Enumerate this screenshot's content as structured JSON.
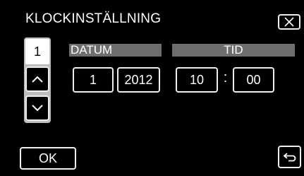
{
  "header": {
    "title": "KLOCKINSTÄLLNING"
  },
  "icons": {
    "close": "close-x-icon",
    "back": "return-arrow-icon",
    "up": "chevron-up-icon",
    "down": "chevron-down-icon"
  },
  "stepper": {
    "value": "1"
  },
  "date": {
    "label": "DATUM",
    "day": "1",
    "year": "2012"
  },
  "time": {
    "label": "TID",
    "hour": "10",
    "separator": ":",
    "minute": "00"
  },
  "footer": {
    "ok_label": "OK"
  },
  "colors": {
    "background": "#000000",
    "header_bar": "#6e6e6e",
    "border": "#ededed",
    "stepper_frame": "#bdbdbd"
  }
}
